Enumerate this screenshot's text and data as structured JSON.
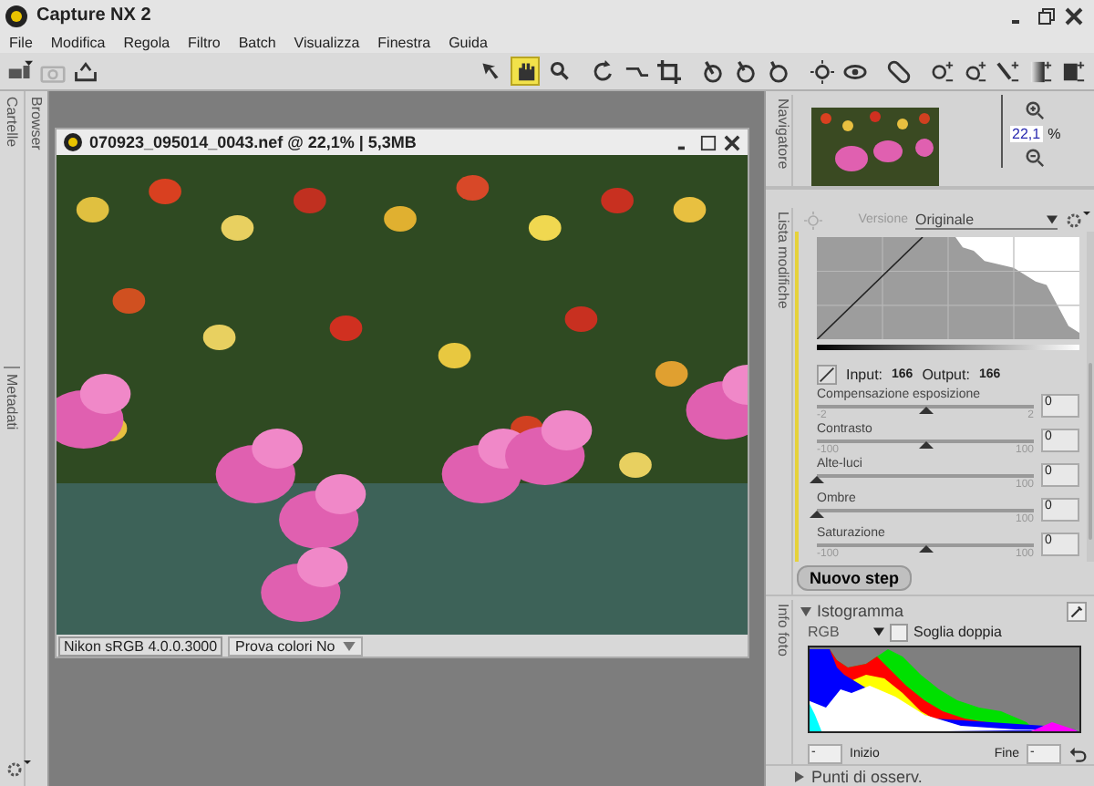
{
  "window": {
    "title": "Capture NX 2"
  },
  "menu": [
    {
      "label": "File"
    },
    {
      "label": "Modifica"
    },
    {
      "label": "Regola"
    },
    {
      "label": "Filtro"
    },
    {
      "label": "Batch"
    },
    {
      "label": "Visualizza"
    },
    {
      "label": "Finestra"
    },
    {
      "label": "Guida"
    }
  ],
  "tools": [
    {
      "kind": "arrow",
      "selected": false
    },
    {
      "kind": "hand",
      "selected": true
    },
    {
      "kind": "zoom",
      "selected": false
    }
  ],
  "side_tabs": [
    {
      "label": "Cartelle"
    },
    {
      "label": "Browser"
    },
    {
      "label": "Metadati"
    }
  ],
  "document": {
    "title": "070923_095014_0043.nef @ 22,1% | 5,3MB",
    "profile": "Nikon sRGB 4.0.0.3000",
    "soft_proof": "Prova colori No"
  },
  "navigator": {
    "tab": "Navigatore",
    "zoom": "22,1",
    "unit": "%"
  },
  "edit_list": {
    "tab": "Lista modifiche",
    "version_label": "Versione",
    "version": "Originale",
    "input_label": "Input:",
    "input": "166",
    "output_label": "Output:",
    "output": "166",
    "sliders": [
      {
        "label": "Compensazione esposizione",
        "min": "-2",
        "max": "2",
        "level": 0.5,
        "value": "0"
      },
      {
        "label": "Contrasto",
        "min": "-100",
        "max": "100",
        "level": 0.5,
        "value": "0"
      },
      {
        "label": "Alte-luci",
        "max": "100",
        "level": 0,
        "value": "0"
      },
      {
        "label": "Ombre",
        "max": "100",
        "level": 0,
        "value": "0"
      },
      {
        "label": "Saturazione",
        "min": "-100",
        "max": "100",
        "level": 0.5,
        "value": "0"
      }
    ],
    "new_step": "Nuovo step"
  },
  "histogram": {
    "tab": "Info foto",
    "title": "Istogramma",
    "expanded": true,
    "channel": "RGB",
    "dual_threshold": {
      "label": "Soglia doppia",
      "checked": false
    },
    "start": "-",
    "start_label": "Inizio",
    "end_label": "Fine",
    "end": "-"
  },
  "watch_points": {
    "title": "Punti di osserv.",
    "expanded": false
  }
}
